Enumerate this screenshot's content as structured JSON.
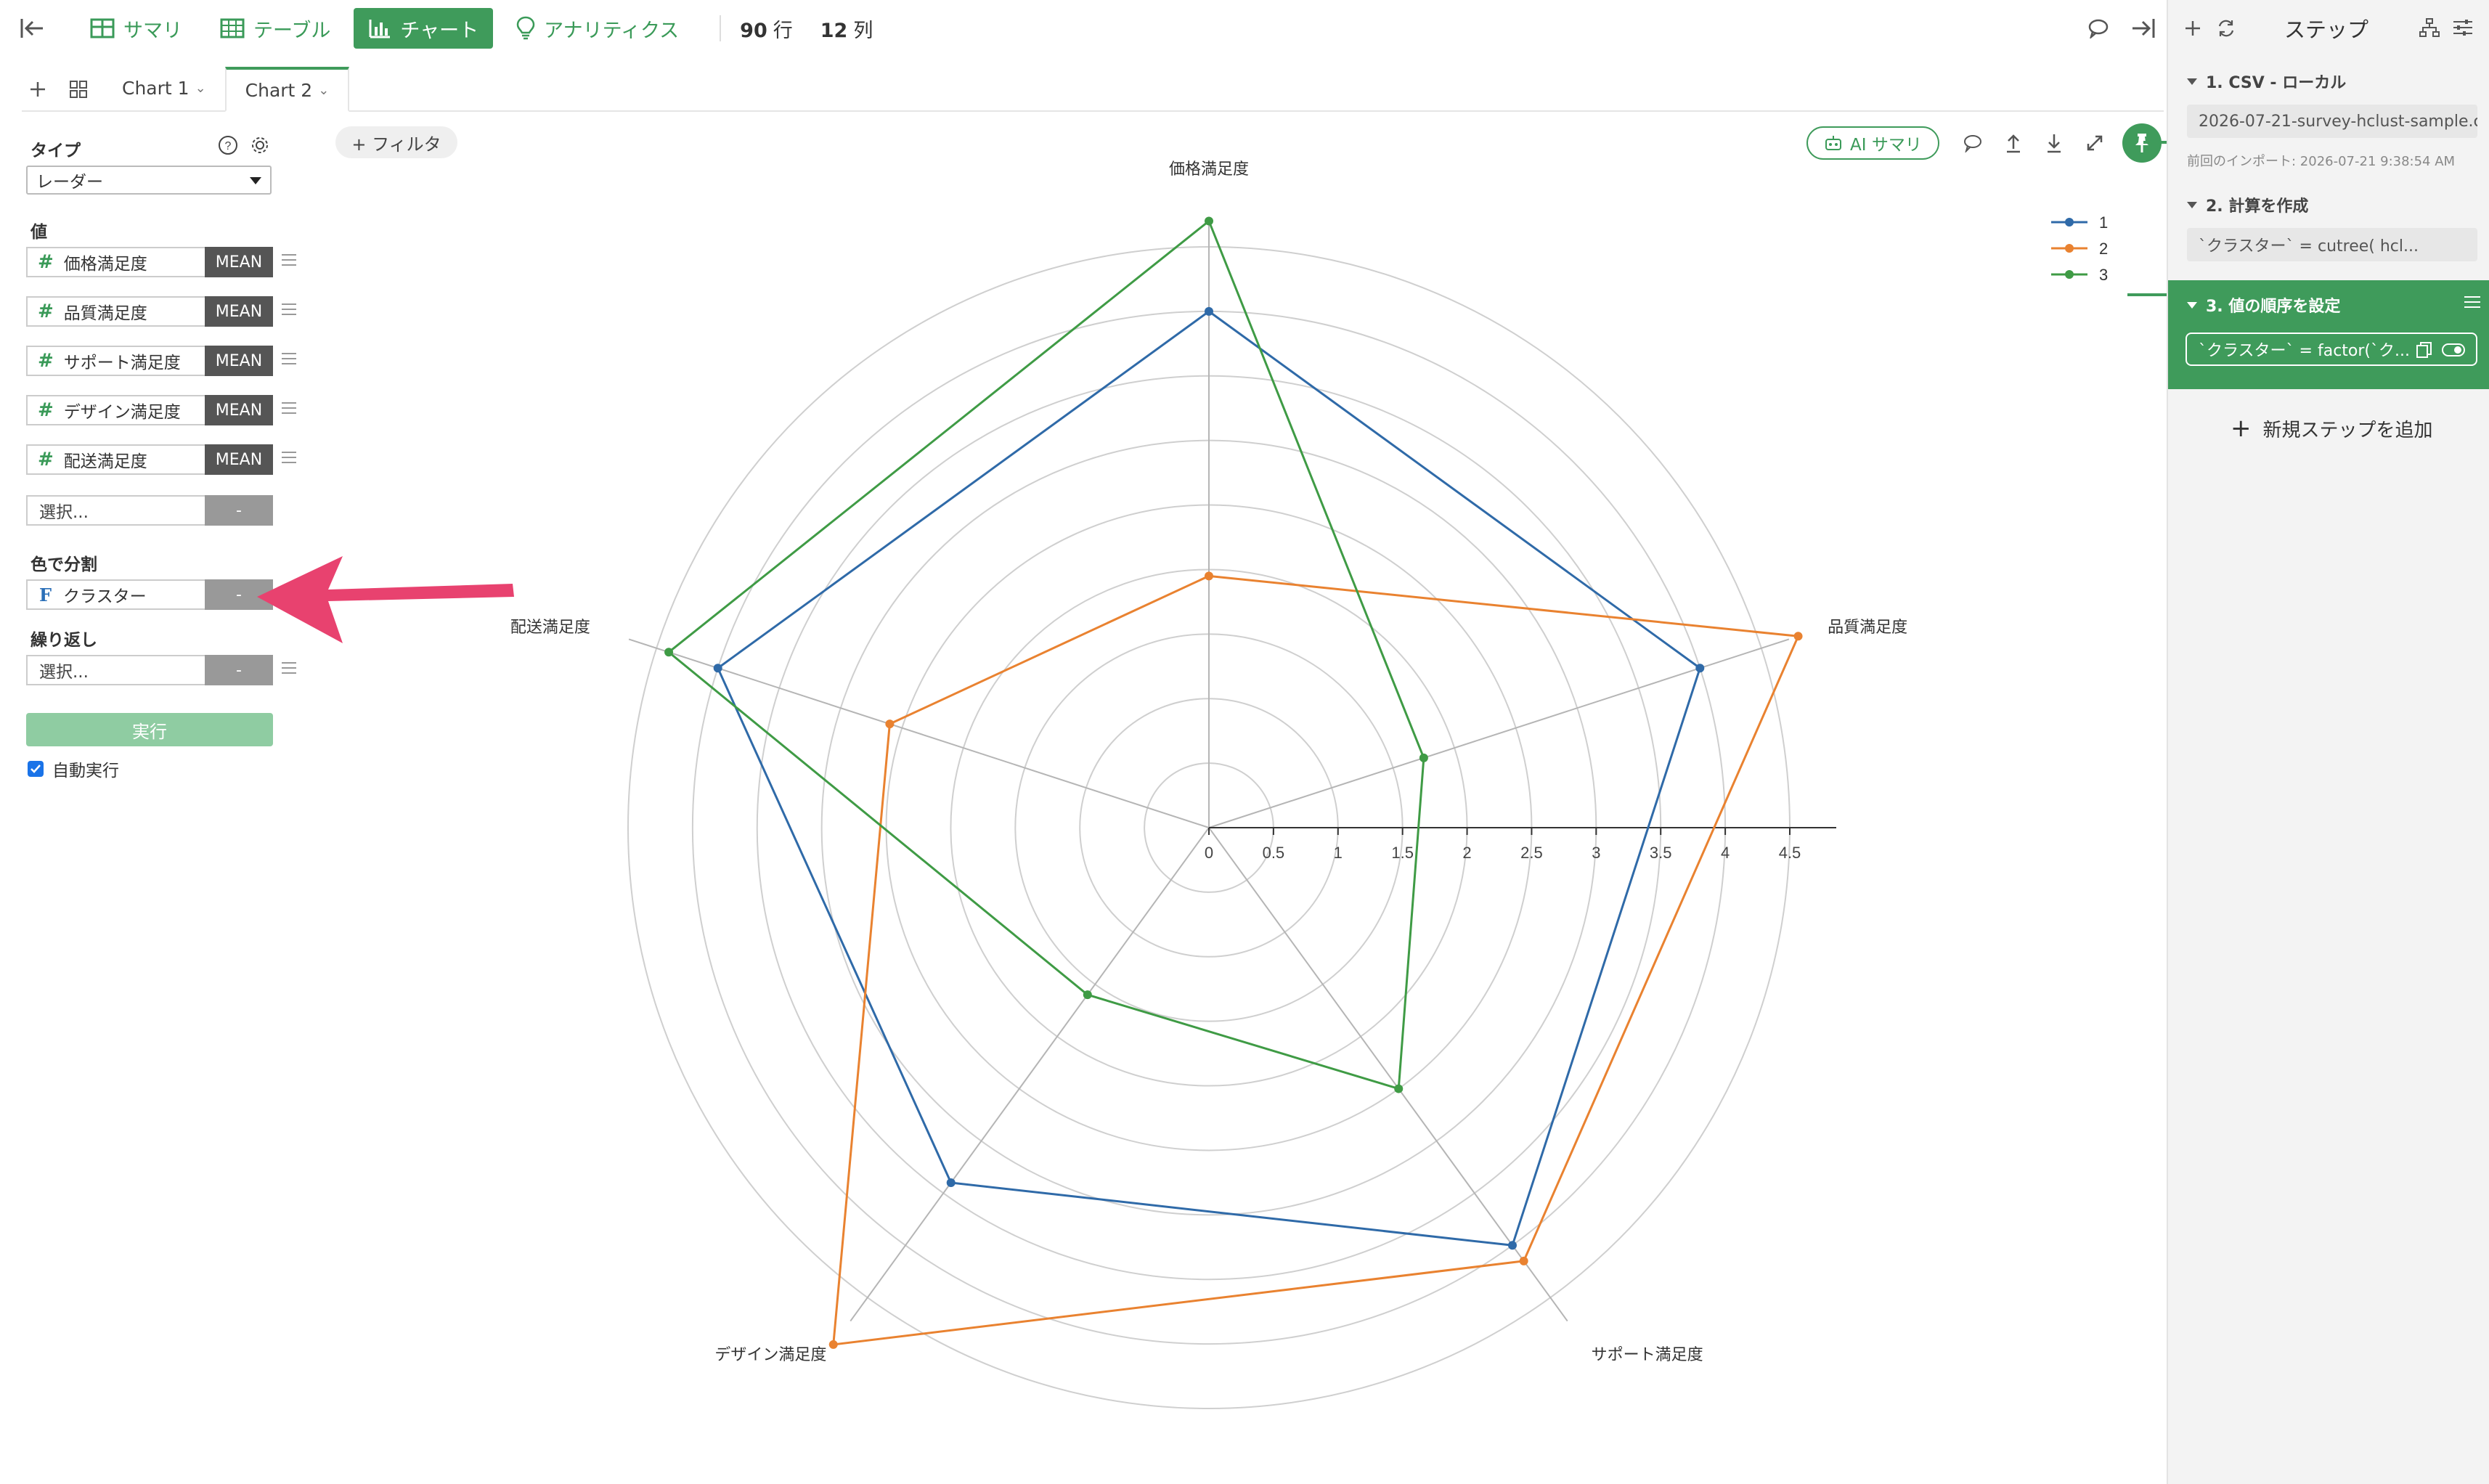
{
  "toolbar": {
    "tabs": [
      {
        "label": "サマリ",
        "icon": "summary-table-icon"
      },
      {
        "label": "テーブル",
        "icon": "table-icon"
      },
      {
        "label": "チャート",
        "icon": "bar-chart-icon"
      },
      {
        "label": "アナリティクス",
        "icon": "lightbulb-icon"
      }
    ],
    "rows_value": "90",
    "rows_unit": "行",
    "cols_value": "12",
    "cols_unit": "列",
    "accent_color": "#3f9b5b"
  },
  "chart_tabs": [
    {
      "label": "Chart 1"
    },
    {
      "label": "Chart 2"
    }
  ],
  "config": {
    "type_label": "タイプ",
    "type_value": "レーダー",
    "values_label": "値",
    "values": [
      {
        "name": "価格満足度",
        "agg": "MEAN"
      },
      {
        "name": "品質満足度",
        "agg": "MEAN"
      },
      {
        "name": "サポート満足度",
        "agg": "MEAN"
      },
      {
        "name": "デザイン満足度",
        "agg": "MEAN"
      },
      {
        "name": "配送満足度",
        "agg": "MEAN"
      }
    ],
    "select_placeholder": "選択...",
    "dash": "-",
    "color_label": "色で分割",
    "color_value": "クラスター",
    "repeat_label": "繰り返し",
    "repeat_placeholder": "選択...",
    "run_label": "実行",
    "auto_run_label": "自動実行"
  },
  "chart_header": {
    "filter_label": "+ フィルタ",
    "ai_label": "AI サマリ"
  },
  "chart_data": {
    "type": "radar",
    "axes": [
      "価格満足度",
      "品質満足度",
      "サポート満足度",
      "デザイン満足度",
      "配送満足度"
    ],
    "ticks": [
      "0",
      "0.5",
      "1",
      "1.5",
      "2",
      "2.5",
      "3",
      "3.5",
      "4",
      "4.5"
    ],
    "range": [
      0,
      4.5
    ],
    "grid": true,
    "legend_position": "top-right",
    "series": [
      {
        "name": "1",
        "color": "#2f6aa8",
        "values": [
          4.0,
          4.0,
          4.0,
          3.4,
          4.0
        ]
      },
      {
        "name": "2",
        "color": "#e98230",
        "values": [
          1.95,
          4.8,
          4.15,
          4.95,
          2.6
        ]
      },
      {
        "name": "3",
        "color": "#3f9b45",
        "values": [
          4.7,
          1.75,
          2.5,
          1.6,
          4.4
        ]
      }
    ]
  },
  "steps_panel": {
    "title": "ステップ",
    "steps": [
      {
        "title": "1. CSV - ローカル",
        "detail": "2026-07-21-survey-hclust-sample.c...",
        "note": "前回のインポート: 2026-07-21 9:38:54 AM"
      },
      {
        "title": "2. 計算を作成",
        "detail": "`クラスター` = cutree( hcl..."
      },
      {
        "title": "3. 値の順序を設定",
        "detail": "`クラスター` = factor(`ク..."
      }
    ],
    "add_step_label": "新規ステップを追加"
  }
}
